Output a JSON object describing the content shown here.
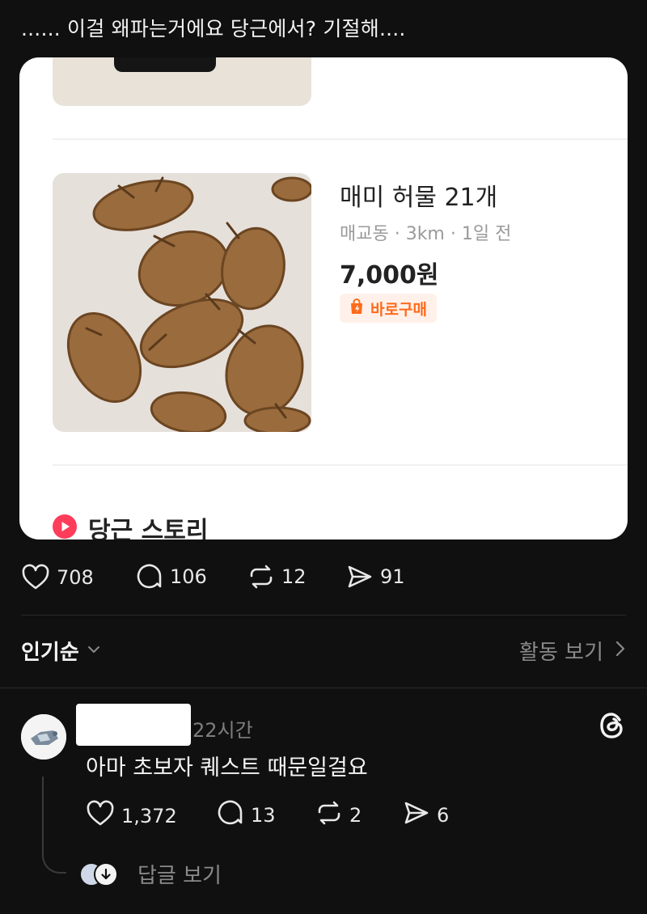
{
  "post": {
    "text": "...... 이걸 왜파는거에요 당근에서? 기절해...."
  },
  "listing": {
    "title": "매미 허물 21개",
    "meta": "매교동 · 3km · 1일 전",
    "price": "7,000원",
    "badge": "바로구매",
    "section_label": "당근 스토리"
  },
  "post_actions": {
    "likes": "708",
    "comments": "106",
    "reposts": "12",
    "shares": "91"
  },
  "sort": {
    "label": "인기순",
    "activity_link": "활동 보기"
  },
  "comment": {
    "time": "22시간",
    "text": "아마 초보자 퀘스트 때문일걸요",
    "likes": "1,372",
    "comments": "13",
    "reposts": "2",
    "shares": "6",
    "view_replies": "답글 보기"
  },
  "colors": {
    "background": "#101010",
    "accent_orange": "#ff6a1a",
    "story_red": "#ff3d5a"
  }
}
